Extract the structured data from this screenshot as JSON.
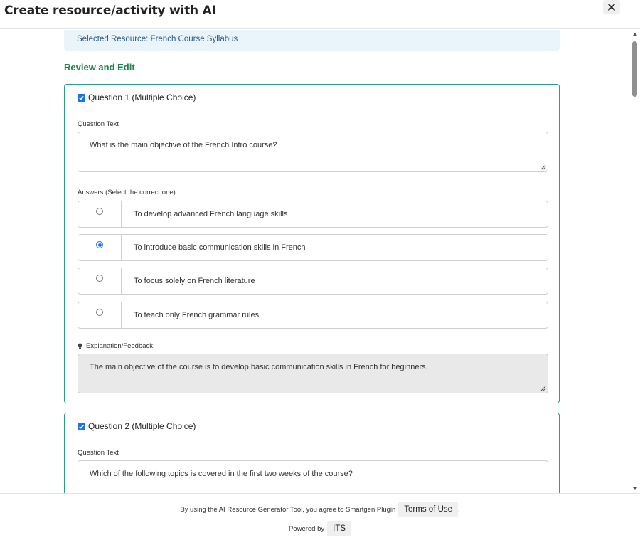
{
  "modal": {
    "title": "Create resource/activity with AI"
  },
  "selected_resource": "Selected Resource: French Course Syllabus",
  "section_title": "Review and Edit",
  "questions": [
    {
      "header": "Question 1 (Multiple Choice)",
      "checked": true,
      "question_label": "Question Text",
      "question_text": "What is the main objective of the French Intro course?",
      "answers_label": "Answers (Select the correct one)",
      "answers": [
        {
          "text": "To develop advanced French language skills",
          "selected": false
        },
        {
          "text": "To introduce basic communication skills in French",
          "selected": true
        },
        {
          "text": "To focus solely on French literature",
          "selected": false
        },
        {
          "text": "To teach only French grammar rules",
          "selected": false
        }
      ],
      "explanation_label": "Explanation/Feedback:",
      "explanation_text": "The main objective of the course is to develop basic communication skills in French for beginners."
    },
    {
      "header": "Question 2 (Multiple Choice)",
      "checked": true,
      "question_label": "Question Text",
      "question_text": "Which of the following topics is covered in the first two weeks of the course?"
    }
  ],
  "footer": {
    "agree_text": "By using the AI Resource Generator Tool, you agree to Smartgen Plugin",
    "terms_label": "Terms of Use",
    "period": ".",
    "powered_by": "Powered by",
    "its_label": "ITS"
  },
  "colors": {
    "accent_green": "#1e8449",
    "card_border": "#27a08a",
    "primary": "#1a73e8"
  }
}
